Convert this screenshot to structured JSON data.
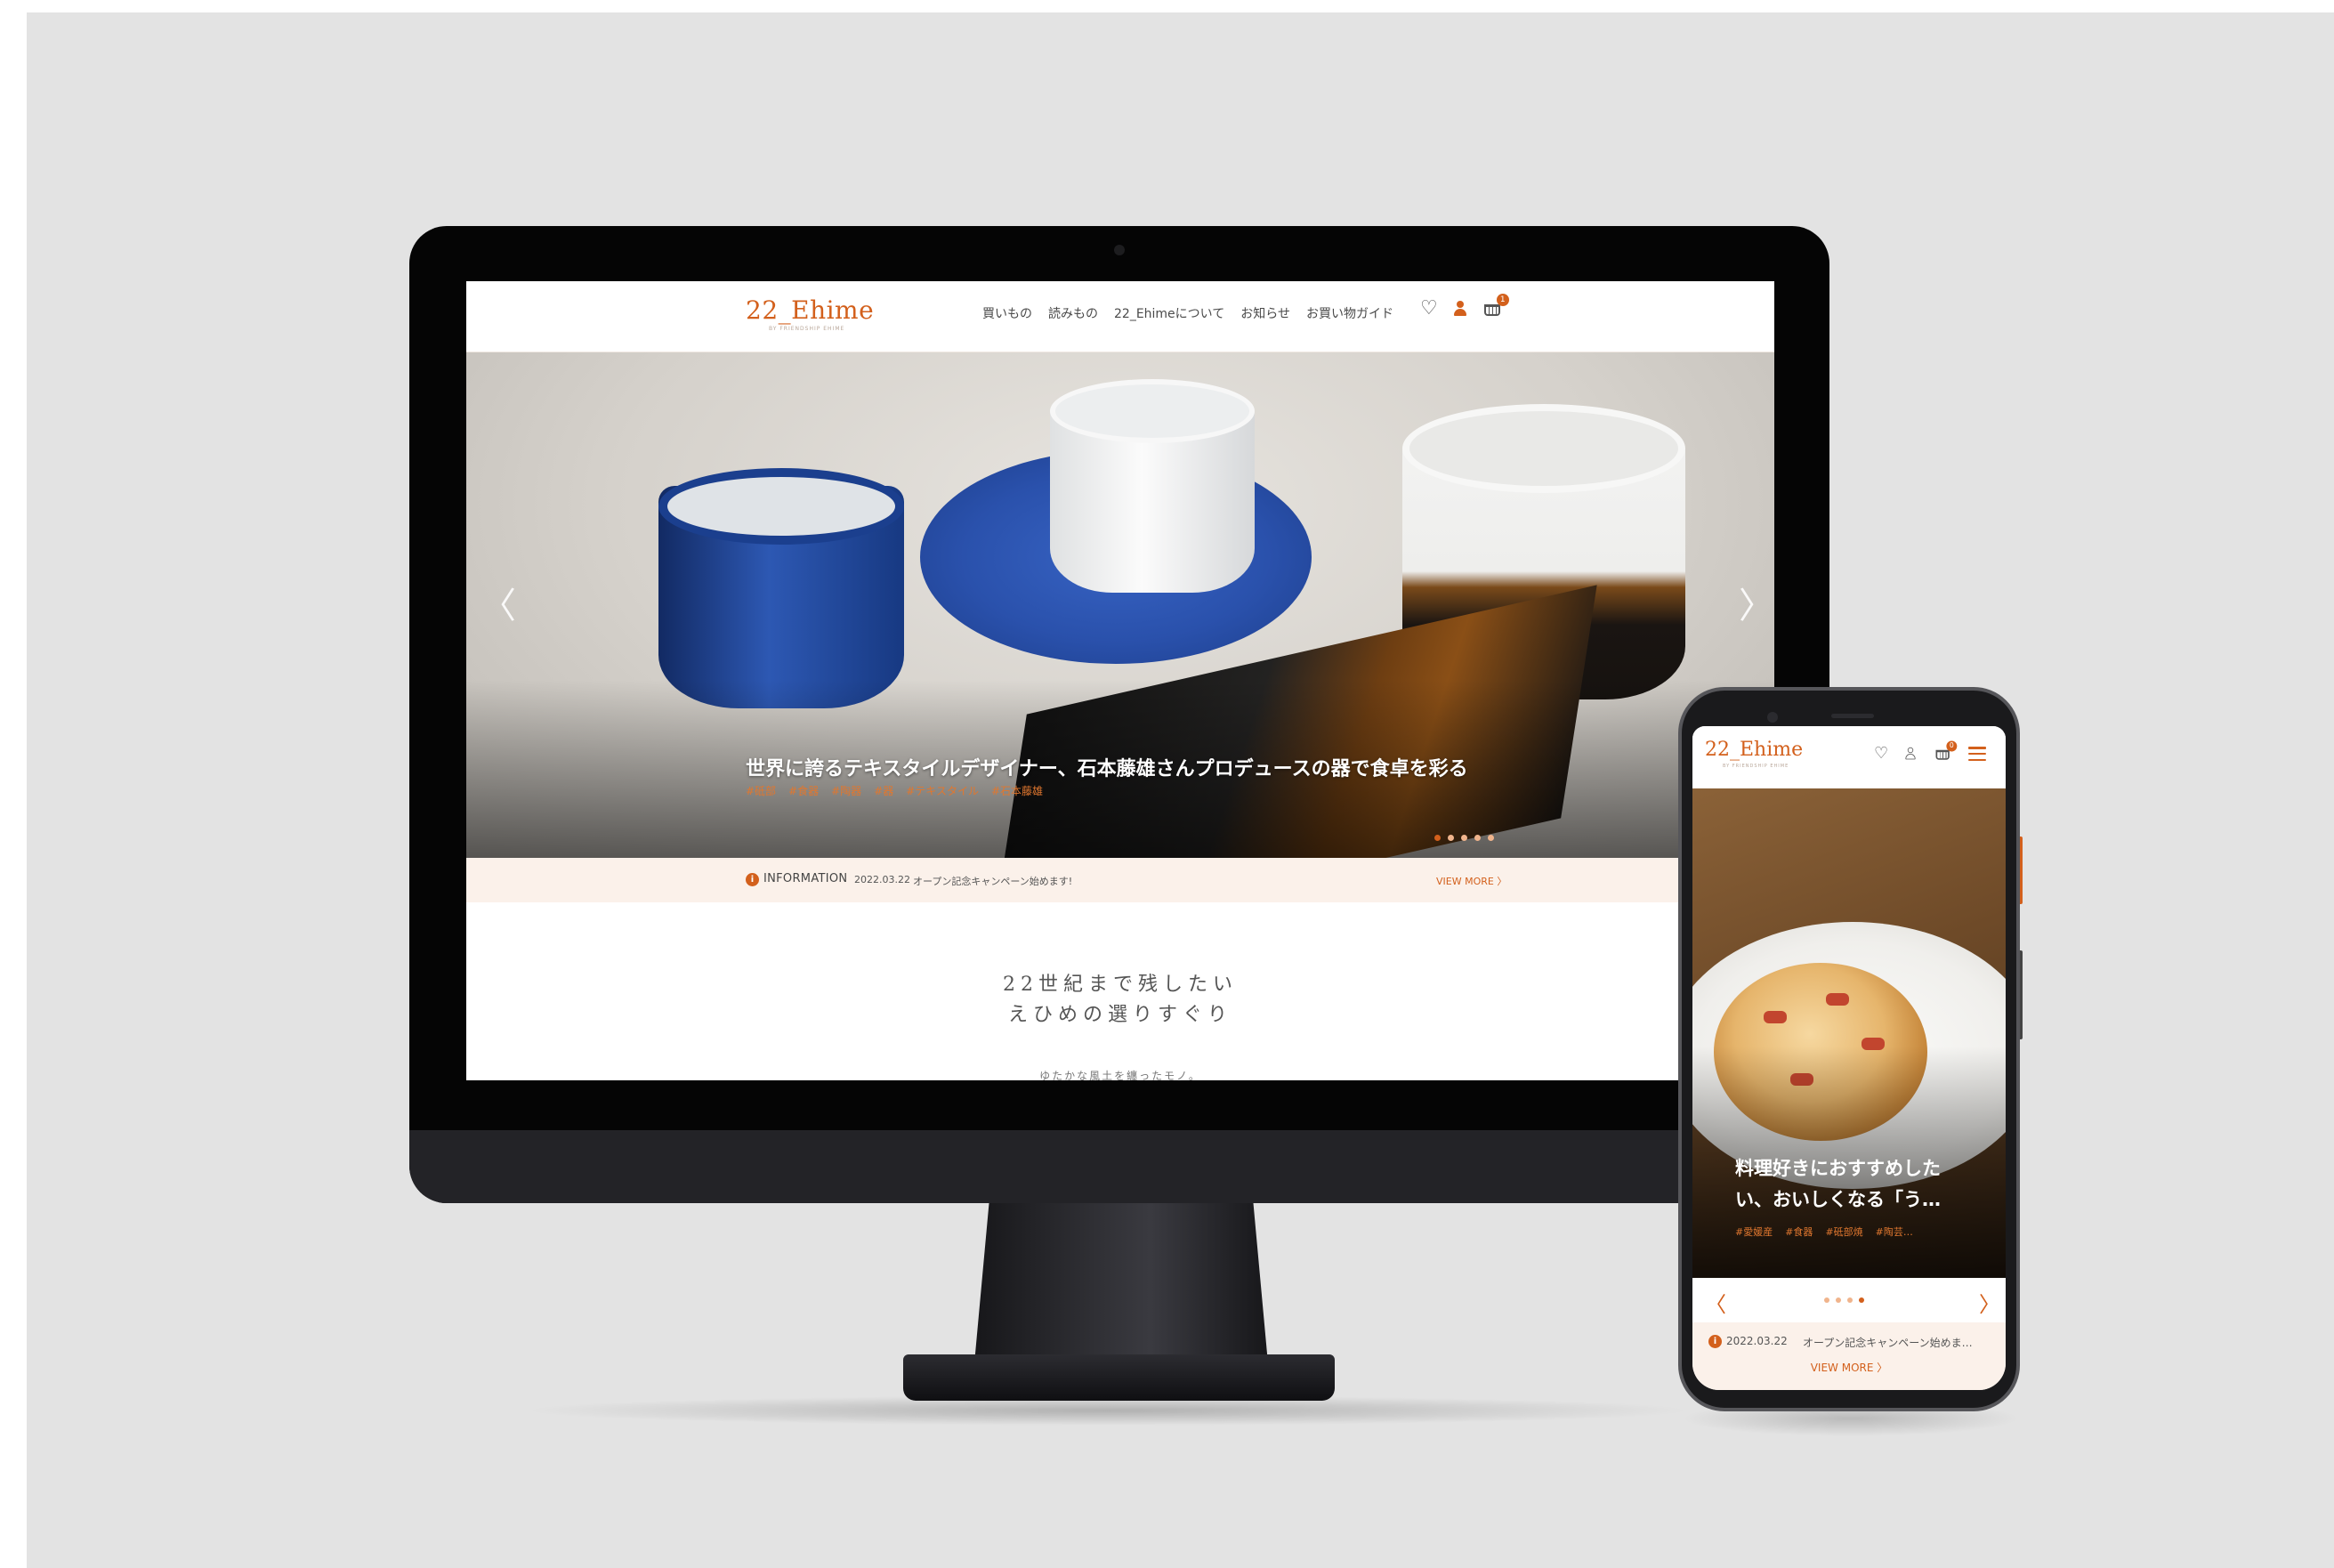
{
  "desktop": {
    "logo": "22_Ehime",
    "logo_sub": "BY FRIENDSHIP EHIME",
    "nav": [
      "買いもの",
      "読みもの",
      "22_Ehimeについて",
      "お知らせ",
      "お買い物ガイド"
    ],
    "cart_count": "1",
    "hero": {
      "caption": "世界に誇るテキスタイルデザイナー、石本藤雄さんプロデュースの器で食卓を彩る",
      "tags": [
        "#砥部",
        "#食器",
        "#陶器",
        "#器",
        "#テキスタイル",
        "#石本藤雄"
      ],
      "prev": "〈",
      "next": "〉",
      "slide_count": 5,
      "active_slide": 1
    },
    "info": {
      "icon": "i",
      "label": "INFORMATION",
      "date": "2022.03.22",
      "text": "オープン記念キャンペーン始めます!",
      "more": "VIEW MORE 〉"
    },
    "intro": {
      "line1": "22世紀まで残したい",
      "line2": "えひめの選りすぐり",
      "sub": "ゆたかな風土を纏ったモノ。"
    }
  },
  "mobile": {
    "logo": "22_Ehime",
    "logo_sub": "BY FRIENDSHIP EHIME",
    "cart_count": "0",
    "hero": {
      "caption": "料理好きにおすすめしたい、おいしくなる「う…",
      "tags": [
        "#愛媛産",
        "#食器",
        "#砥部焼",
        "#陶芸…"
      ],
      "prev": "〈",
      "next": "〉",
      "slide_count": 4,
      "active_slide": 4
    },
    "info": {
      "icon": "i",
      "date": "2022.03.22",
      "text": "オープン記念キャンペーン始めま…",
      "more": "VIEW MORE 〉"
    }
  },
  "colors": {
    "accent": "#d3601c",
    "info_bg": "#fbf1ea",
    "backdrop": "#e3e3e3",
    "device": "#050505"
  },
  "icons": [
    "heart-icon",
    "user-icon",
    "cart-icon",
    "menu-icon",
    "info-icon"
  ]
}
